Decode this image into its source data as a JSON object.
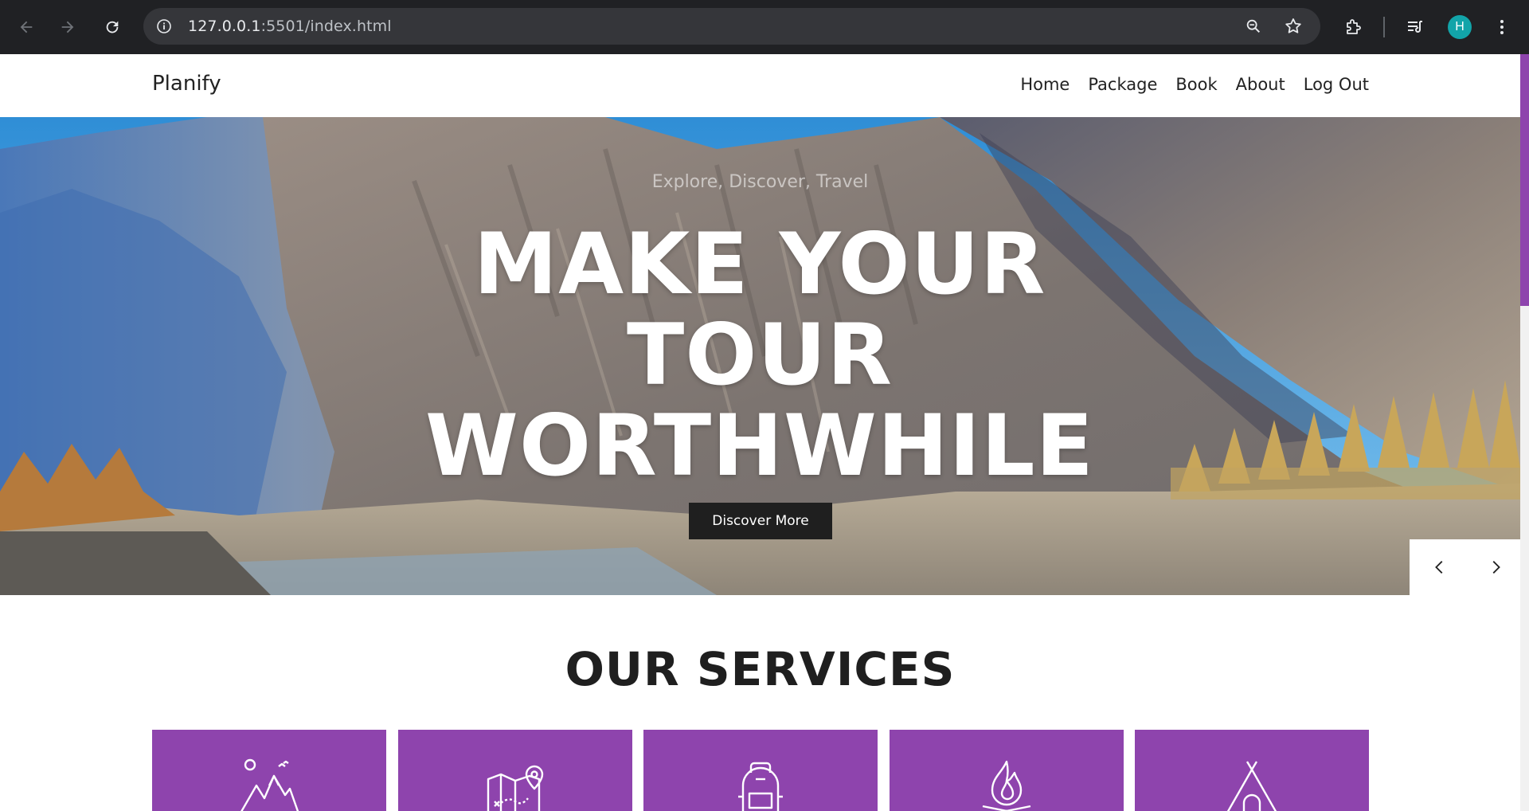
{
  "browser": {
    "url_host": "127.0.0.1",
    "url_path": ":5501/index.html",
    "profile_initial": "H",
    "profile_color": "#12a4a9",
    "icons": [
      "back-icon",
      "forward-icon",
      "reload-icon",
      "site-info-icon",
      "zoom-icon",
      "bookmark-star-icon",
      "extensions-icon",
      "media-controls-icon",
      "more-menu-icon"
    ]
  },
  "site": {
    "brand": "Planify",
    "menu": [
      {
        "label": "Home"
      },
      {
        "label": "Package"
      },
      {
        "label": "Book"
      },
      {
        "label": "About"
      },
      {
        "label": "Log Out"
      }
    ],
    "accent_color": "#8e44ad"
  },
  "hero": {
    "subtitle": "Explore, Discover, Travel",
    "title_line1": "MAKE YOUR",
    "title_line2": "TOUR",
    "title_line3": "WORTHWHILE",
    "cta_label": "Discover More",
    "prev_icon": "chevron-left-icon",
    "next_icon": "chevron-right-icon"
  },
  "services": {
    "title": "OUR SERVICES",
    "cards": [
      {
        "icon": "mountains-icon"
      },
      {
        "icon": "map-pin-icon"
      },
      {
        "icon": "backpack-icon"
      },
      {
        "icon": "campfire-icon"
      },
      {
        "icon": "tent-icon"
      }
    ]
  }
}
